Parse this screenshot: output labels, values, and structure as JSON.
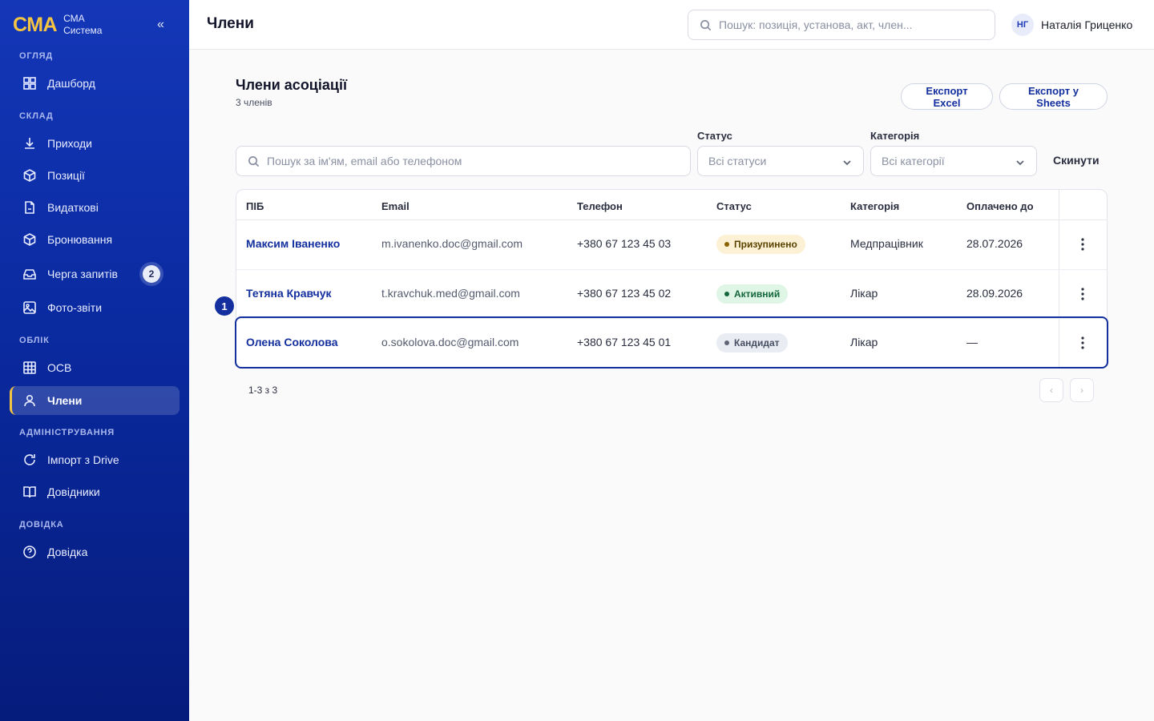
{
  "brand": {
    "logo": "СМА",
    "line1": "СМА",
    "line2": "Система",
    "collapse_glyph": "«"
  },
  "sidebar": {
    "sections": {
      "overview": "ОГЛЯД",
      "warehouse": "СКЛАД",
      "accounting": "ОБЛІК",
      "admin": "АДМІНІСТРУВАННЯ",
      "help": "ДОВІДКА"
    },
    "items": {
      "dashboard": "Дашборд",
      "incomes": "Приходи",
      "positions": "Позиції",
      "expenses": "Видаткові",
      "bookings": "Бронювання",
      "queue": "Черга запитів",
      "queue_badge": "2",
      "photos": "Фото-звіти",
      "osv": "ОСВ",
      "members": "Члени",
      "import": "Імпорт з Drive",
      "directories": "Довідники",
      "help": "Довідка"
    }
  },
  "header": {
    "title": "Члени",
    "search_placeholder": "Пошук: позиція, установа, акт, член...",
    "user_initials": "НГ",
    "user_name": "Наталія Гриценко"
  },
  "main": {
    "heading": "Члени асоціації",
    "count": "3 членів",
    "export_excel": "Експорт Excel",
    "export_sheets": "Експорт у Sheets",
    "search_placeholder": "Пошук за ім'ям, email або телефоном",
    "status_label": "Статус",
    "status_value": "Всі статуси",
    "category_label": "Категорія",
    "category_value": "Всі категорії",
    "reset": "Скинути"
  },
  "table": {
    "columns": [
      "ПІБ",
      "Email",
      "Телефон",
      "Статус",
      "Категорія",
      "Оплачено до"
    ],
    "rows": [
      {
        "name": "Максим Іваненко",
        "email": "m.ivanenko.doc@gmail.com",
        "phone": "+380 67 123 45 03",
        "status": "Призупинено",
        "category": "Медпрацівник",
        "paid_until": "28.07.2026"
      },
      {
        "name": "Тетяна Кравчук",
        "email": "t.kravchuk.med@gmail.com",
        "phone": "+380 67 123 45 02",
        "status": "Активний",
        "category": "Лікар",
        "paid_until": "28.09.2026"
      },
      {
        "name": "Олена Соколова",
        "email": "o.sokolova.doc@gmail.com",
        "phone": "+380 67 123 45 01",
        "status": "Кандидат",
        "category": "Лікар",
        "paid_until": "—"
      }
    ]
  },
  "row_marker": "1",
  "pagination": {
    "info": "1-3 з 3",
    "prev": "‹",
    "next": "›"
  },
  "colors": {
    "accent": "#14309e",
    "brand_yellow": "#f5c542",
    "sidebar_top": "#1437b8",
    "sidebar_bottom": "#061c7c"
  }
}
